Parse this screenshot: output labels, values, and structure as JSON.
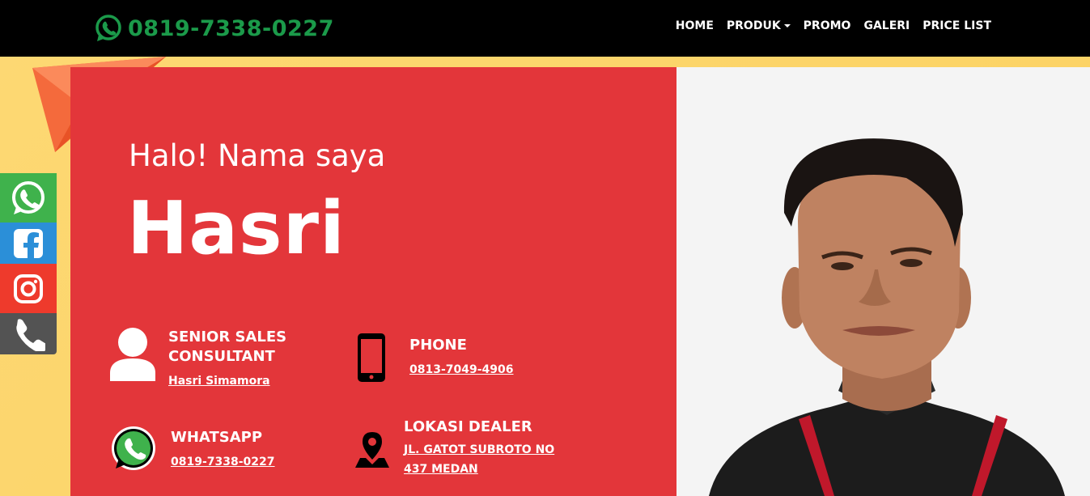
{
  "navbar": {
    "phone": "0819-7338-0227",
    "menu": [
      {
        "label": "HOME"
      },
      {
        "label": "PRODUK"
      },
      {
        "label": "PROMO"
      },
      {
        "label": "GALERI"
      },
      {
        "label": "PRICE LIST"
      }
    ]
  },
  "hero": {
    "greeting": "Halo! Nama saya",
    "name": "Hasri"
  },
  "info": {
    "role": {
      "title": "SENIOR SALES CONSULTANT",
      "value": "Hasri Simamora",
      "icon": "user-icon"
    },
    "phone": {
      "title": "PHONE",
      "value": "0813-7049-4906",
      "icon": "smartphone-icon"
    },
    "whatsapp": {
      "title": "WHATSAPP",
      "value": "0819-7338-0227",
      "icon": "whatsapp-icon"
    },
    "dealer": {
      "title": "LOKASI DEALER",
      "value": "JL. GATOT SUBROTO NO 437 MEDAN",
      "icon": "map-pin-icon"
    }
  },
  "social": [
    {
      "icon": "whatsapp-icon",
      "color": "#3fb24c"
    },
    {
      "icon": "facebook-icon",
      "color": "#2b8fd8"
    },
    {
      "icon": "instagram-icon",
      "color": "#ee3a2c"
    },
    {
      "icon": "phone-icon",
      "color": "#535353"
    }
  ],
  "colors": {
    "navbar_bg": "#000000",
    "phone_green": "#1b9a4a",
    "card_red": "#e3363a",
    "background_yellow": "#fcd86a"
  }
}
